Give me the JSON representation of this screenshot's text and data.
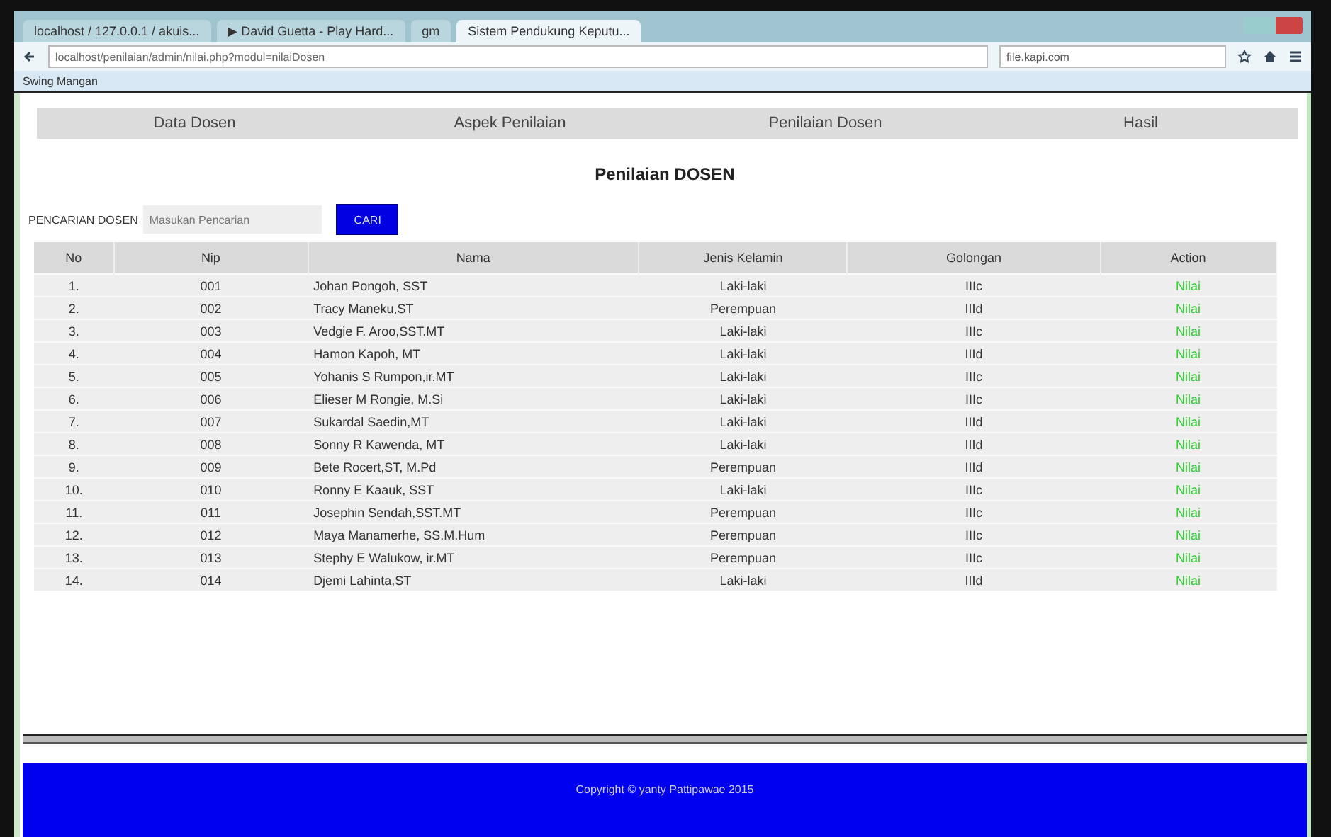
{
  "browser": {
    "tabs": [
      {
        "title": "localhost / 127.0.0.1 / akuis...",
        "selected": false
      },
      {
        "title": "▶ David Guetta - Play Hard...",
        "selected": false
      },
      {
        "title": "gm",
        "selected": false
      },
      {
        "title": "Sistem Pendukung Keputu...",
        "selected": true
      }
    ],
    "url": "localhost/penilaian/admin/nilai.php?modul=nilaiDosen",
    "search": "file.kapi.com",
    "bookmarks": [
      "Swing Mangan"
    ]
  },
  "nav": [
    "Data Dosen",
    "Aspek Penilaian",
    "Penilaian Dosen",
    "Hasil"
  ],
  "title": "Penilaian DOSEN",
  "search": {
    "label": "PENCARIAN DOSEN",
    "placeholder": "Masukan Pencarian",
    "button": "CARI"
  },
  "table": {
    "columns": [
      "No",
      "Nip",
      "Nama",
      "Jenis Kelamin",
      "Golongan",
      "Action"
    ],
    "rows": [
      [
        "1.",
        "001",
        "Johan Pongoh, SST",
        "Laki-laki",
        "IIIc",
        "Nilai"
      ],
      [
        "2.",
        "002",
        "Tracy Maneku,ST",
        "Perempuan",
        "IIId",
        "Nilai"
      ],
      [
        "3.",
        "003",
        "Vedgie F. Aroo,SST.MT",
        "Laki-laki",
        "IIIc",
        "Nilai"
      ],
      [
        "4.",
        "004",
        "Hamon Kapoh, MT",
        "Laki-laki",
        "IIId",
        "Nilai"
      ],
      [
        "5.",
        "005",
        "Yohanis S Rumpon,ir.MT",
        "Laki-laki",
        "IIIc",
        "Nilai"
      ],
      [
        "6.",
        "006",
        "Elieser M Rongie, M.Si",
        "Laki-laki",
        "IIIc",
        "Nilai"
      ],
      [
        "7.",
        "007",
        "Sukardal Saedin,MT",
        "Laki-laki",
        "IIId",
        "Nilai"
      ],
      [
        "8.",
        "008",
        "Sonny R Kawenda, MT",
        "Laki-laki",
        "IIId",
        "Nilai"
      ],
      [
        "9.",
        "009",
        "Bete Rocert,ST, M.Pd",
        "Perempuan",
        "IIId",
        "Nilai"
      ],
      [
        "10.",
        "010",
        "Ronny E Kaauk, SST",
        "Laki-laki",
        "IIIc",
        "Nilai"
      ],
      [
        "11.",
        "011",
        "Josephin Sendah,SST.MT",
        "Perempuan",
        "IIIc",
        "Nilai"
      ],
      [
        "12.",
        "012",
        "Maya Manamerhe, SS.M.Hum",
        "Perempuan",
        "IIIc",
        "Nilai"
      ],
      [
        "13.",
        "013",
        "Stephy E Walukow, ir.MT",
        "Perempuan",
        "IIIc",
        "Nilai"
      ],
      [
        "14.",
        "014",
        "Djemi Lahinta,ST",
        "Laki-laki",
        "IIId",
        "Nilai"
      ]
    ]
  },
  "footer": "Copyright © yanty Pattipawae 2015"
}
